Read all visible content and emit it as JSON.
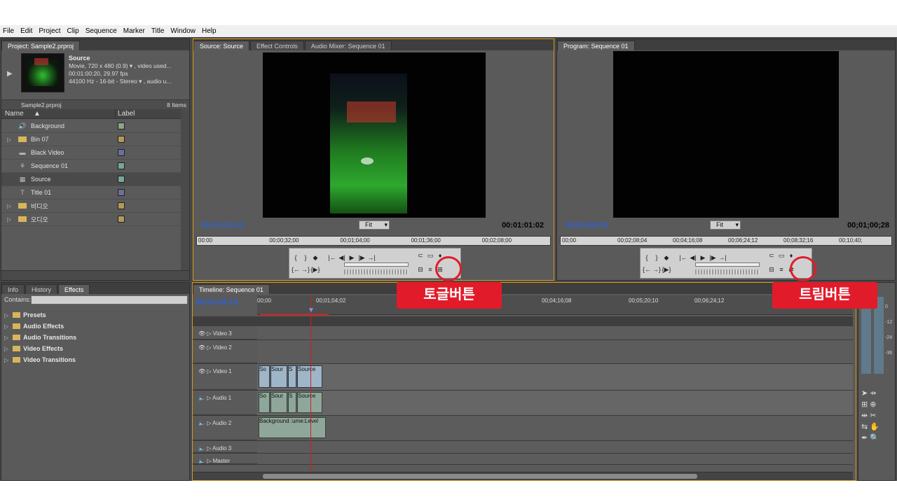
{
  "menu": [
    "File",
    "Edit",
    "Project",
    "Clip",
    "Sequence",
    "Marker",
    "Title",
    "Window",
    "Help"
  ],
  "project_panel": {
    "tab": "Project: Sample2.prproj",
    "clip_name": "Source",
    "clip_info": [
      "Movie, 720 x 480 (0.9)",
      "00:01:00:20, 29.97 fps",
      "44100 Hz - 16-bit - Stereo"
    ],
    "clip_info_extra": [
      ", video used...",
      "",
      ", audio u..."
    ],
    "file_name": "Sample2.prproj",
    "items_count": "8 Items",
    "col_name": "Name",
    "col_label": "Label",
    "items": [
      {
        "name": "Background",
        "icon": "audio-icon",
        "color": "#8fa487"
      },
      {
        "name": "Bin 07",
        "icon": "folder-icon",
        "color": "#b39a5a"
      },
      {
        "name": "Black Video",
        "icon": "video-icon",
        "color": "#6b6f9c"
      },
      {
        "name": "Sequence 01",
        "icon": "sequence-icon",
        "color": "#7aa59a"
      },
      {
        "name": "Source",
        "icon": "film-icon",
        "color": "#7aa59a"
      },
      {
        "name": "Title 01",
        "icon": "title-icon",
        "color": "#6b6f9c"
      },
      {
        "name": "비디오",
        "icon": "folder-icon",
        "color": "#b39a5a"
      },
      {
        "name": "오디오",
        "icon": "folder-icon",
        "color": "#b39a5a"
      }
    ]
  },
  "source_monitor": {
    "tabs": [
      "Source: Source",
      "Effect Controls",
      "Audio Mixer: Sequence 01"
    ],
    "tc_current": "00:01:15:12",
    "tc_duration": "00:01:01:02",
    "fit": "Fit",
    "ruler": [
      "00:00",
      "00;00;32;00",
      "00;01;04;00",
      "00;01;36;00",
      "00;02;08;00"
    ]
  },
  "program_monitor": {
    "tab": "Program: Sequence 01",
    "tc_current": "00;01;00;28",
    "tc_duration": "00;01;00;28",
    "fit": "Fit",
    "ruler": [
      "00;00",
      "00;02;08;04",
      "00;04;16;08",
      "00;06;24;12",
      "00;08;32;16",
      "00;10;40;"
    ]
  },
  "effects_panel": {
    "tabs": [
      "Info",
      "History",
      "Effects"
    ],
    "contains_label": "Contains:",
    "items": [
      "Presets",
      "Audio Effects",
      "Audio Transitions",
      "Video Effects",
      "Video Transitions"
    ]
  },
  "timeline": {
    "tab": "Timeline: Sequence 01",
    "tc": "00;00;44;16",
    "ruler": [
      "00;00",
      "00;01;04;02",
      "00;04;16;08",
      "00;05;20;10",
      "00;06;24;12"
    ],
    "tracks": [
      {
        "name": "Video 3",
        "kind": "video"
      },
      {
        "name": "Video 2",
        "kind": "video"
      },
      {
        "name": "Video 1",
        "kind": "video"
      },
      {
        "name": "Audio 1",
        "kind": "audio"
      },
      {
        "name": "Audio 2",
        "kind": "audio"
      },
      {
        "name": "Audio 3",
        "kind": "audio"
      },
      {
        "name": "Master",
        "kind": "audio"
      }
    ],
    "v1_clips": [
      "So",
      "Sour",
      "S",
      "Source"
    ],
    "a1_clips": [
      "So",
      "Sour",
      "S",
      "Source"
    ],
    "a2_clip": "Background :ume:Level"
  },
  "meter_labels": [
    "0",
    "-12",
    "-24",
    "-36"
  ],
  "callouts": {
    "toggle": "토글버튼",
    "trim": "트림버튼"
  },
  "accent": "#e21b2a"
}
